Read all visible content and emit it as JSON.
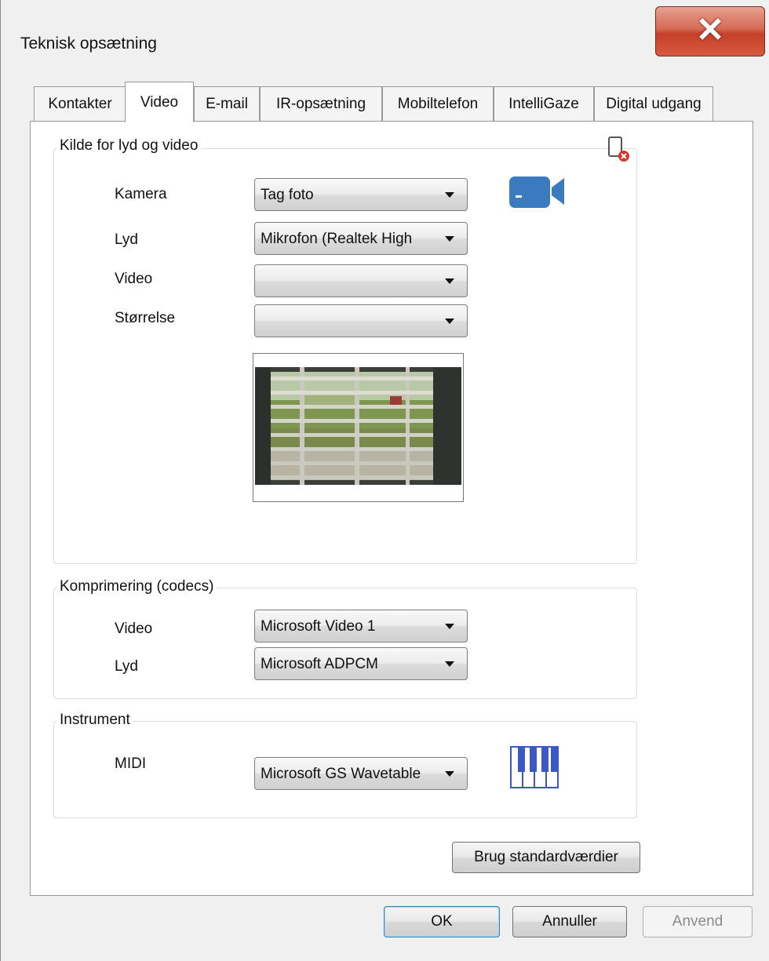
{
  "window": {
    "title": "Teknisk opsætning"
  },
  "tabs": [
    "Kontakter",
    "Video",
    "E-mail",
    "IR-opsætning",
    "Mobiltelefon",
    "IntelliGaze",
    "Digital udgang"
  ],
  "source_group": {
    "legend": "Kilde for lyd og video",
    "rows": [
      {
        "label": "Kamera",
        "value": "Tag foto"
      },
      {
        "label": "Lyd",
        "value": "Mikrofon (Realtek High"
      },
      {
        "label": "Video",
        "value": ""
      },
      {
        "label": "Størrelse",
        "value": ""
      }
    ]
  },
  "codec_group": {
    "legend": "Komprimering (codecs)",
    "rows": [
      {
        "label": "Video",
        "value": "Microsoft Video 1"
      },
      {
        "label": "Lyd",
        "value": "Microsoft ADPCM"
      }
    ]
  },
  "instrument_group": {
    "legend": "Instrument",
    "rows": [
      {
        "label": "MIDI",
        "value": "Microsoft GS Wavetable"
      }
    ]
  },
  "buttons": {
    "defaults": "Brug standardværdier",
    "ok": "OK",
    "cancel": "Annuller",
    "apply": "Anvend"
  },
  "icons": {
    "close": "close-icon",
    "remove_device": "device-remove-icon",
    "camera": "video-camera-icon",
    "piano": "piano-keyboard-icon"
  },
  "colors": {
    "close_red": "#c4402a",
    "camera_blue": "#3a7bbf",
    "piano_blue": "#3b58c4"
  }
}
